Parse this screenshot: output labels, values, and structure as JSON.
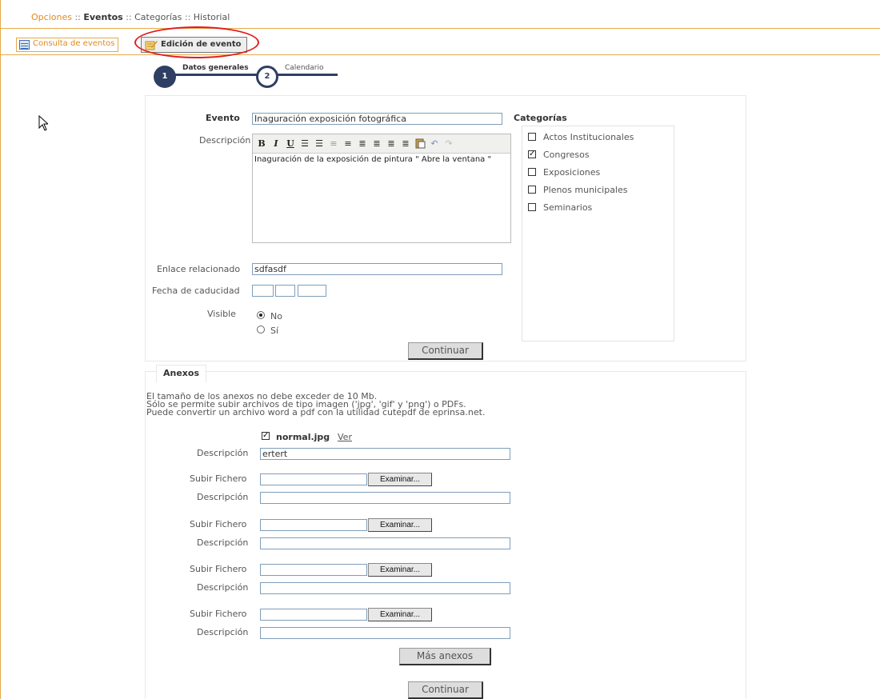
{
  "topnav": {
    "opciones": "Opciones",
    "sep1": " :: ",
    "eventos": "Eventos",
    "sep2": " :: ",
    "categorias": "Categorías",
    "sep3": " :: ",
    "historial": "Historial"
  },
  "tabs": {
    "consulta": "Consulta de eventos",
    "edicion": "Edición de evento"
  },
  "wizard": {
    "step1_num": "1",
    "step1_label": "Datos generales",
    "step2_num": "2",
    "step2_label": "Calendario"
  },
  "form": {
    "evento_label": "Evento",
    "evento_value": "Inaguración exposición fotográfica",
    "descripcion_label": "Descripción",
    "descripcion_value": "Inaguración de la exposición de pintura \" Abre la ventana \"",
    "enlace_label": "Enlace relacionado",
    "enlace_value": "sdfasdf",
    "fecha_label": "Fecha de caducidad",
    "visible_label": "Visible",
    "visible_no": "No",
    "visible_si": "Sí",
    "continuar": "Continuar"
  },
  "categorias": {
    "title": "Categorías",
    "items": [
      {
        "label": "Actos Institucionales",
        "checked": false
      },
      {
        "label": "Congresos",
        "checked": true
      },
      {
        "label": "Exposiciones",
        "checked": false
      },
      {
        "label": "Plenos municipales",
        "checked": false
      },
      {
        "label": "Seminarios",
        "checked": false
      }
    ]
  },
  "anexos": {
    "title": "Anexos",
    "note1": "El tamaño de los anexos no debe exceder de 10 Mb.",
    "note2": "Sólo se permite subir archivos de tipo imagen ('jpg', 'gif' y 'png') o PDFs.",
    "note3": "Puede convertir un archivo word a pdf con la utilidad cutepdf de eprinsa.net.",
    "existing_file": "normal.jpg",
    "ver": "Ver",
    "existing_desc_label": "Descripción",
    "existing_desc_value": "ertert",
    "subir_label": "Subir Fichero",
    "desc_label": "Descripción",
    "examinar": "Examinar...",
    "mas_anexos": "Más anexos",
    "continuar": "Continuar"
  }
}
